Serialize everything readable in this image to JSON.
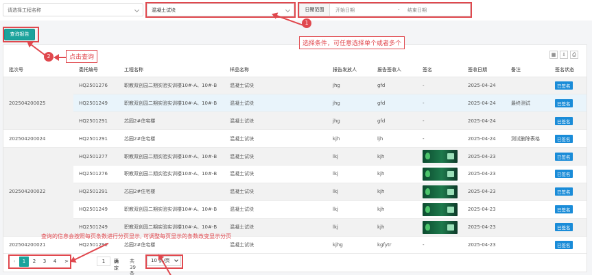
{
  "filters": {
    "project_placeholder": "请选择工程名称",
    "sample_value": "混凝土试块",
    "date_label": "日期范围",
    "date_start_placeholder": "开始日期",
    "date_separator": "-",
    "date_end_placeholder": "结束日期"
  },
  "query_button_label": "查询报告",
  "annotations": {
    "step1_number": "1",
    "step1_text": "选择条件，可任意选择单个或者多个",
    "step2_number": "2",
    "step2_text": "点击查询",
    "pagination_note": "查询的信息会按照每页条数进行分页显示, 可调整每页显示的条数改变显示分页"
  },
  "table": {
    "headers": [
      "批次号",
      "委托编号",
      "工程名称",
      "样品名称",
      "报告发放人",
      "报告签收人",
      "签名",
      "签收日期",
      "备注",
      "签名状态"
    ],
    "batches": [
      {
        "batch": "202504200025",
        "rows": [
          {
            "code": "HQ2501276",
            "project": "职教双创园二期实验实训楼10#-A、10#-B",
            "sample": "混凝土试块",
            "issuer": "jhg",
            "receiver": "gfd",
            "sign": "-",
            "date": "2025-04-24",
            "remark": "",
            "status": "已签名"
          },
          {
            "code": "HQ2501249",
            "project": "职教双创园二期实验实训楼10#-A、10#-B",
            "sample": "混凝土试块",
            "issuer": "jhg",
            "receiver": "gfd",
            "sign": "-",
            "date": "2025-04-24",
            "remark": "最终测试",
            "status": "已签名"
          },
          {
            "code": "HQ2501291",
            "project": "芯园2#住宅楼",
            "sample": "混凝土试块",
            "issuer": "jhg",
            "receiver": "gfd",
            "sign": "-",
            "date": "2025-04-24",
            "remark": "",
            "status": "已签名"
          }
        ]
      },
      {
        "batch": "202504200024",
        "rows": [
          {
            "code": "HQ2501291",
            "project": "芯园2#住宅楼",
            "sample": "混凝土试块",
            "issuer": "kjh",
            "receiver": "ljh",
            "sign": "-",
            "date": "2025-04-24",
            "remark": "测试删除表格",
            "status": "已签名"
          }
        ]
      },
      {
        "batch": "202504200022",
        "rows": [
          {
            "code": "HQ2501277",
            "project": "职教双创园二期实验实训楼10#-A、10#-B",
            "sample": "混凝土试块",
            "issuer": "lkj",
            "receiver": "kjh",
            "sign": "img",
            "date": "2025-04-23",
            "remark": "",
            "status": "已签名"
          },
          {
            "code": "HQ2501276",
            "project": "职教双创园二期实验实训楼10#-A、10#-B",
            "sample": "混凝土试块",
            "issuer": "lkj",
            "receiver": "kjh",
            "sign": "img",
            "date": "2025-04-23",
            "remark": "",
            "status": "已签名"
          },
          {
            "code": "HQ2501291",
            "project": "芯园2#住宅楼",
            "sample": "混凝土试块",
            "issuer": "lkj",
            "receiver": "kjh",
            "sign": "img",
            "date": "2025-04-23",
            "remark": "",
            "status": "已签名"
          },
          {
            "code": "HQ2501249",
            "project": "职教双创园二期实验实训楼10#-A、10#-B",
            "sample": "混凝土试块",
            "issuer": "lkj",
            "receiver": "kjh",
            "sign": "img",
            "date": "2025-04-23",
            "remark": "",
            "status": "已签名"
          },
          {
            "code": "HQ2501249",
            "project": "职教双创园二期实验实训楼10#-A、10#-B",
            "sample": "混凝土试块",
            "issuer": "lkj",
            "receiver": "kjh",
            "sign": "img",
            "date": "2025-04-23",
            "remark": "",
            "status": "已签名"
          }
        ]
      },
      {
        "batch": "202504200021",
        "rows": [
          {
            "code": "HQ2501291",
            "project": "芯园2#住宅楼",
            "sample": "混凝土试块",
            "issuer": "kjhg",
            "receiver": "kgfytr",
            "sign": "-",
            "date": "2025-04-23",
            "remark": "",
            "status": "已签名"
          }
        ]
      }
    ]
  },
  "pagination": {
    "pages": [
      "1",
      "2",
      "3",
      "4"
    ],
    "current": "1",
    "next_symbol": ">",
    "goto_value": "1",
    "confirm_label": "确定",
    "total_text": "共 39 条",
    "page_size": "10 条/页"
  },
  "colors": {
    "accent": "#1ba39c",
    "annotation_red": "#e0484e",
    "badge_blue": "#1a8cd8"
  },
  "icons": [
    "column-toggle-icon",
    "export-icon",
    "print-icon",
    "chevron-down-icon"
  ]
}
